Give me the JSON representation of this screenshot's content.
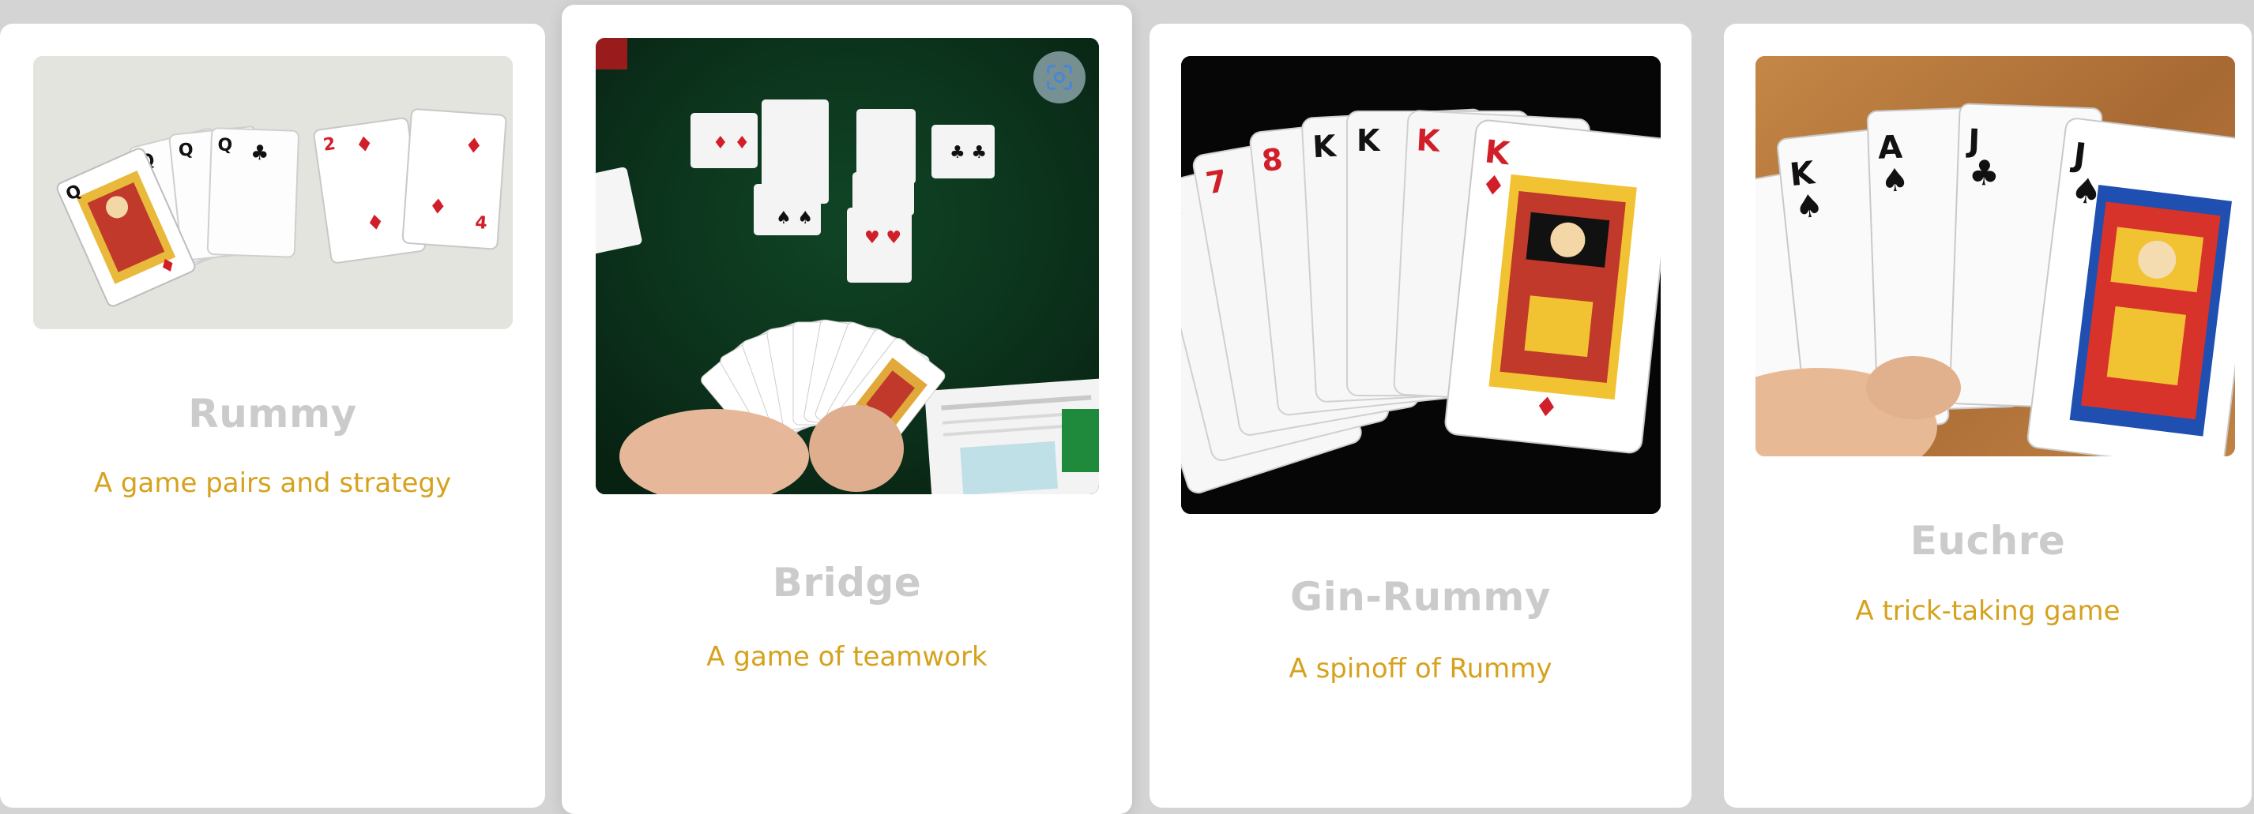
{
  "colors": {
    "page_background": "#d4d4d4",
    "card_background": "#ffffff",
    "title_color": "#cbcbcb",
    "description_color": "#d6a21e",
    "felt_green": "#0c3a1f",
    "red_suit": "#d11f2a",
    "black_suit": "#111111"
  },
  "cards": [
    {
      "title": "Rummy",
      "description": "A game pairs and strategy",
      "image_icon": "playing-cards-photo"
    },
    {
      "title": "Bridge",
      "description": "A game of teamwork",
      "image_icon": "playing-cards-photo",
      "overlay_icon": "visual-search-icon"
    },
    {
      "title": "Gin-Rummy",
      "description": "A spinoff of Rummy",
      "image_icon": "playing-cards-photo"
    },
    {
      "title": "Euchre",
      "description": "A trick-taking game",
      "image_icon": "playing-cards-photo"
    }
  ]
}
